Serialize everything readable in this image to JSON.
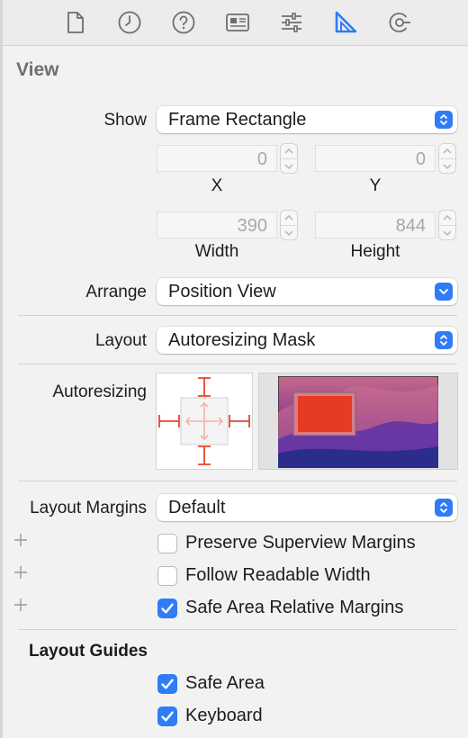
{
  "toolbar": {
    "icons": [
      "file-icon",
      "clock-icon",
      "help-icon",
      "identity-icon",
      "sliders-icon",
      "ruler-icon",
      "connections-icon"
    ],
    "active_icon": "ruler-icon",
    "accent_color": "#2f7cf6"
  },
  "view": {
    "section_title": "View",
    "show": {
      "label": "Show",
      "value": "Frame Rectangle"
    },
    "x": {
      "value": "0",
      "label": "X"
    },
    "y": {
      "value": "0",
      "label": "Y"
    },
    "width": {
      "value": "390",
      "label": "Width"
    },
    "height": {
      "value": "844",
      "label": "Height"
    },
    "arrange": {
      "label": "Arrange",
      "value": "Position View"
    },
    "layout": {
      "label": "Layout",
      "value": "Autoresizing Mask"
    },
    "autoresizing": {
      "label": "Autoresizing",
      "strut_color": "#e8452c"
    },
    "layout_margins": {
      "label": "Layout Margins",
      "value": "Default"
    },
    "margin_options": [
      {
        "label": "Preserve Superview Margins",
        "checked": false
      },
      {
        "label": "Follow Readable Width",
        "checked": false
      },
      {
        "label": "Safe Area Relative Margins",
        "checked": true
      }
    ]
  },
  "layout_guides": {
    "title": "Layout Guides",
    "options": [
      {
        "label": "Safe Area",
        "checked": true
      },
      {
        "label": "Keyboard",
        "checked": true
      }
    ]
  }
}
